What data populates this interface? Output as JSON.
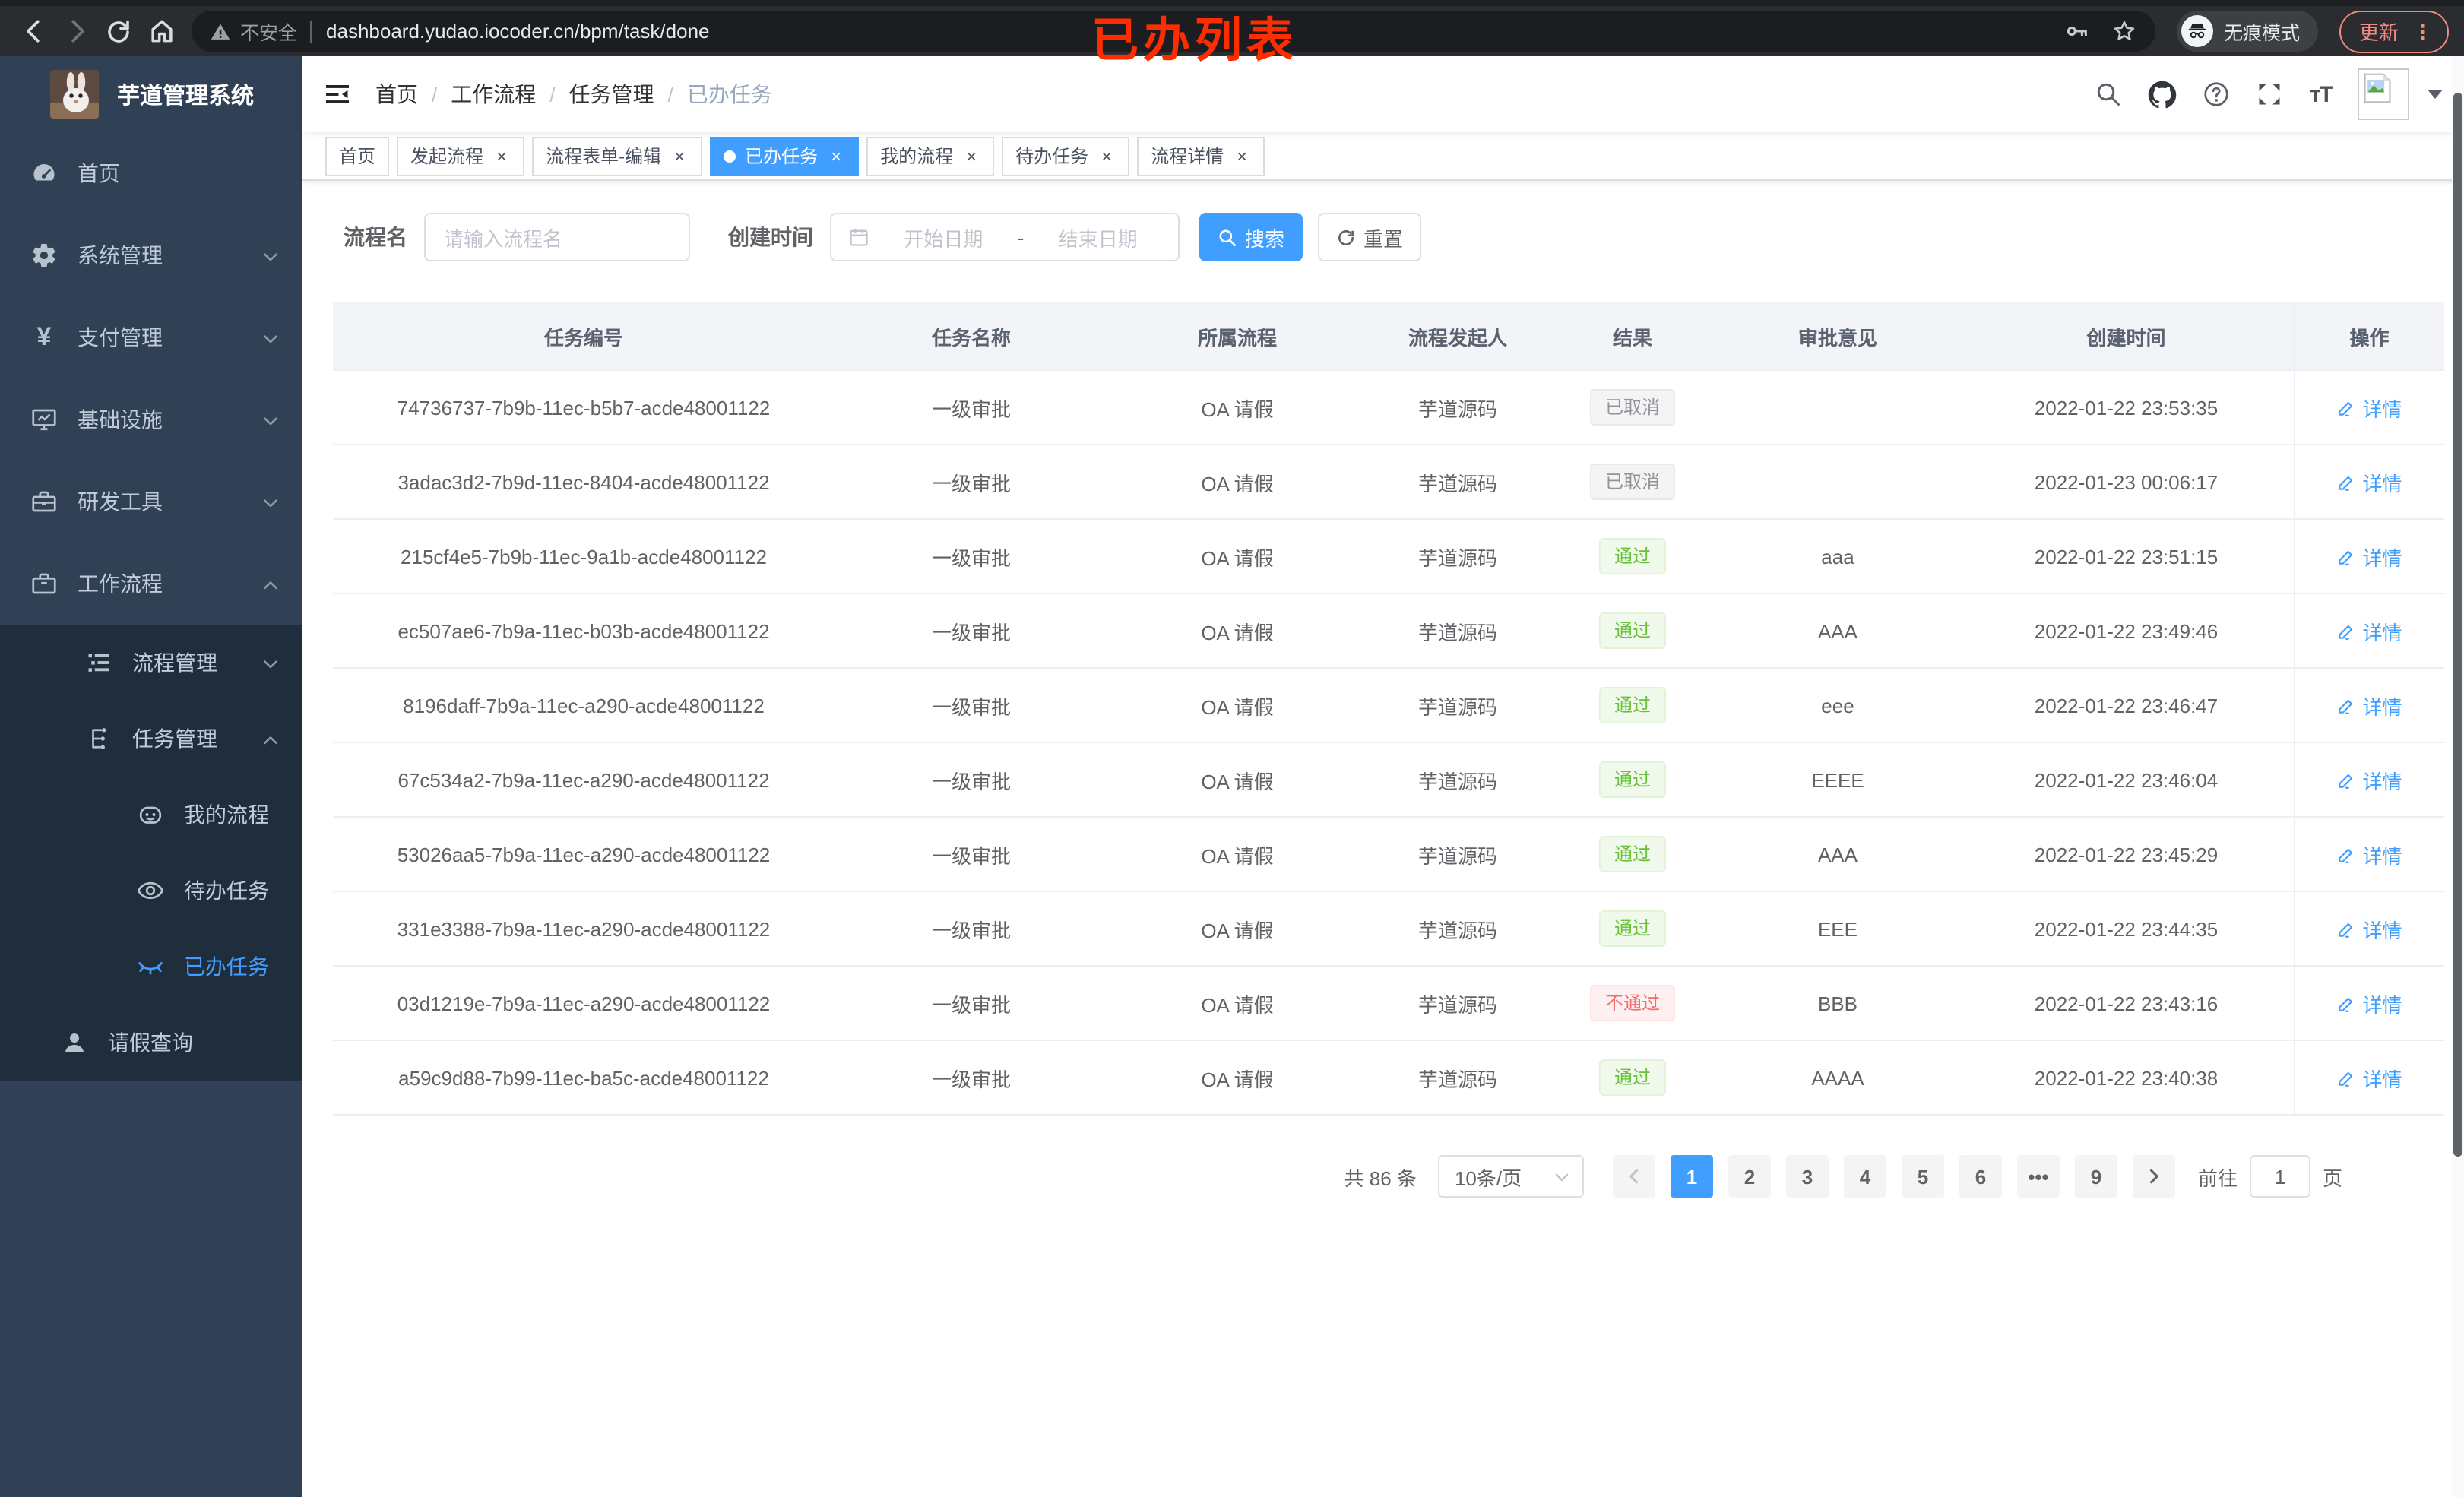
{
  "annotation": "已办列表",
  "chrome": {
    "security_warning": "不安全",
    "url": "dashboard.yudao.iocoder.cn/bpm/task/done",
    "incognito_label": "无痕模式",
    "update_label": "更新",
    "menu_dots": "⋮"
  },
  "sidebar": {
    "title": "芋道管理系统",
    "menu": [
      {
        "id": "home",
        "label": "首页",
        "icon": "dashboard-icon",
        "cls": "lv1"
      },
      {
        "id": "system",
        "label": "系统管理",
        "icon": "gear-icon",
        "cls": "lv1",
        "chevron": "down"
      },
      {
        "id": "payment",
        "label": "支付管理",
        "icon": "yen-icon",
        "cls": "lv1",
        "chevron": "down"
      },
      {
        "id": "infra",
        "label": "基础设施",
        "icon": "monitor-icon",
        "cls": "lv1",
        "chevron": "down"
      },
      {
        "id": "devtools",
        "label": "研发工具",
        "icon": "toolbox-icon",
        "cls": "lv1",
        "chevron": "down"
      },
      {
        "id": "workflow",
        "label": "工作流程",
        "icon": "briefcase-icon",
        "cls": "lv1",
        "chevron": "up"
      }
    ],
    "submenu": [
      {
        "id": "process-mgmt",
        "label": "流程管理",
        "icon": "list-icon",
        "cls": "lv2",
        "chevron": "down"
      },
      {
        "id": "task-mgmt",
        "label": "任务管理",
        "icon": "tree-icon",
        "cls": "lv2",
        "chevron": "up"
      },
      {
        "id": "my-process",
        "label": "我的流程",
        "icon": "robot-icon",
        "cls": "lv3"
      },
      {
        "id": "todo-tasks",
        "label": "待办任务",
        "icon": "eye-icon",
        "cls": "lv3"
      },
      {
        "id": "done-tasks",
        "label": "已办任务",
        "icon": "eye-closed-icon",
        "cls": "lv3",
        "active": true
      },
      {
        "id": "leave-query",
        "label": "请假查询",
        "icon": "user-icon",
        "cls": "lv2-leaf"
      }
    ]
  },
  "navbar": {
    "breadcrumb": [
      "首页",
      "工作流程",
      "任务管理",
      "已办任务"
    ]
  },
  "tabs": [
    {
      "label": "首页",
      "closable": false,
      "active": false
    },
    {
      "label": "发起流程",
      "closable": true,
      "active": false
    },
    {
      "label": "流程表单-编辑",
      "closable": true,
      "active": false
    },
    {
      "label": "已办任务",
      "closable": true,
      "active": true
    },
    {
      "label": "我的流程",
      "closable": true,
      "active": false
    },
    {
      "label": "待办任务",
      "closable": true,
      "active": false
    },
    {
      "label": "流程详情",
      "closable": true,
      "active": false
    }
  ],
  "filters": {
    "name_label": "流程名",
    "name_placeholder": "请输入流程名",
    "time_label": "创建时间",
    "start_placeholder": "开始日期",
    "range_separator": "-",
    "end_placeholder": "结束日期",
    "search_label": "搜索",
    "reset_label": "重置"
  },
  "table": {
    "columns": [
      {
        "key": "id",
        "label": "任务编号"
      },
      {
        "key": "name",
        "label": "任务名称"
      },
      {
        "key": "process",
        "label": "所属流程"
      },
      {
        "key": "starter",
        "label": "流程发起人"
      },
      {
        "key": "result",
        "label": "结果"
      },
      {
        "key": "comment",
        "label": "审批意见"
      },
      {
        "key": "created",
        "label": "创建时间"
      },
      {
        "key": "action",
        "label": "操作"
      }
    ],
    "action_label": "详情",
    "rows": [
      {
        "id": "74736737-7b9b-11ec-b5b7-acde48001122",
        "name": "一级审批",
        "process": "OA 请假",
        "starter": "芋道源码",
        "result": "已取消",
        "result_type": "info",
        "comment": "",
        "created": "2022-01-22 23:53:35"
      },
      {
        "id": "3adac3d2-7b9d-11ec-8404-acde48001122",
        "name": "一级审批",
        "process": "OA 请假",
        "starter": "芋道源码",
        "result": "已取消",
        "result_type": "info",
        "comment": "",
        "created": "2022-01-23 00:06:17"
      },
      {
        "id": "215cf4e5-7b9b-11ec-9a1b-acde48001122",
        "name": "一级审批",
        "process": "OA 请假",
        "starter": "芋道源码",
        "result": "通过",
        "result_type": "success",
        "comment": "aaa",
        "created": "2022-01-22 23:51:15"
      },
      {
        "id": "ec507ae6-7b9a-11ec-b03b-acde48001122",
        "name": "一级审批",
        "process": "OA 请假",
        "starter": "芋道源码",
        "result": "通过",
        "result_type": "success",
        "comment": "AAA",
        "created": "2022-01-22 23:49:46"
      },
      {
        "id": "8196daff-7b9a-11ec-a290-acde48001122",
        "name": "一级审批",
        "process": "OA 请假",
        "starter": "芋道源码",
        "result": "通过",
        "result_type": "success",
        "comment": "eee",
        "created": "2022-01-22 23:46:47"
      },
      {
        "id": "67c534a2-7b9a-11ec-a290-acde48001122",
        "name": "一级审批",
        "process": "OA 请假",
        "starter": "芋道源码",
        "result": "通过",
        "result_type": "success",
        "comment": "EEEE",
        "created": "2022-01-22 23:46:04"
      },
      {
        "id": "53026aa5-7b9a-11ec-a290-acde48001122",
        "name": "一级审批",
        "process": "OA 请假",
        "starter": "芋道源码",
        "result": "通过",
        "result_type": "success",
        "comment": "AAA",
        "created": "2022-01-22 23:45:29"
      },
      {
        "id": "331e3388-7b9a-11ec-a290-acde48001122",
        "name": "一级审批",
        "process": "OA 请假",
        "starter": "芋道源码",
        "result": "通过",
        "result_type": "success",
        "comment": "EEE",
        "created": "2022-01-22 23:44:35"
      },
      {
        "id": "03d1219e-7b9a-11ec-a290-acde48001122",
        "name": "一级审批",
        "process": "OA 请假",
        "starter": "芋道源码",
        "result": "不通过",
        "result_type": "danger",
        "comment": "BBB",
        "created": "2022-01-22 23:43:16"
      },
      {
        "id": "a59c9d88-7b99-11ec-ba5c-acde48001122",
        "name": "一级审批",
        "process": "OA 请假",
        "starter": "芋道源码",
        "result": "通过",
        "result_type": "success",
        "comment": "AAAA",
        "created": "2022-01-22 23:40:38"
      }
    ]
  },
  "pagination": {
    "total_label": "共 86 条",
    "page_size": "10条/页",
    "pages": [
      "1",
      "2",
      "3",
      "4",
      "5",
      "6",
      "•••",
      "9"
    ],
    "active_page": "1",
    "jump_prefix": "前往",
    "jump_value": "1",
    "jump_suffix": "页"
  },
  "colors": {
    "primary": "#409eff",
    "success": "#67c23a",
    "danger": "#f56c6c",
    "info": "#909399",
    "sidebar_bg": "#304156",
    "submenu_bg": "#1f2d3d",
    "annotation_red": "#fd2c01",
    "update_salmon": "#f28b82"
  }
}
